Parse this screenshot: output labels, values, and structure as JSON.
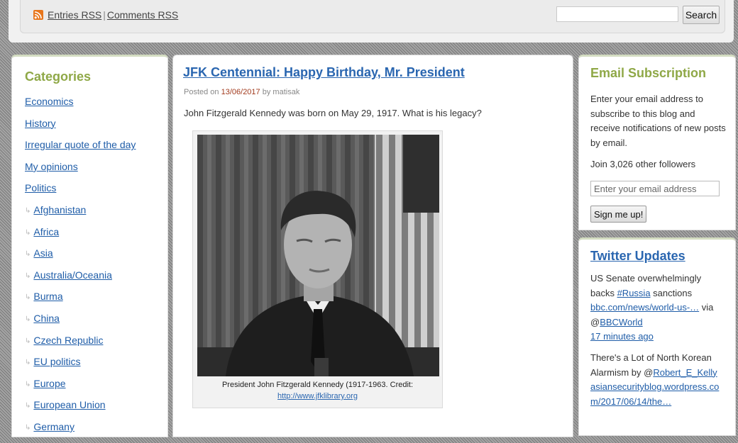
{
  "header": {
    "rss_icon": "rss-icon",
    "entries_rss": "Entries RSS",
    "separator": "|",
    "comments_rss": "Comments RSS",
    "search_placeholder": "",
    "search_button": "Search"
  },
  "sidebar": {
    "title": "Categories",
    "items": [
      {
        "label": "Economics",
        "child": false
      },
      {
        "label": "History",
        "child": false
      },
      {
        "label": "Irregular quote of the day",
        "child": false
      },
      {
        "label": "My opinions",
        "child": false
      },
      {
        "label": "Politics",
        "child": false
      },
      {
        "label": "Afghanistan",
        "child": true
      },
      {
        "label": "Africa",
        "child": true
      },
      {
        "label": "Asia",
        "child": true
      },
      {
        "label": "Australia/Oceania",
        "child": true
      },
      {
        "label": "Burma",
        "child": true
      },
      {
        "label": "China",
        "child": true
      },
      {
        "label": "Czech Republic",
        "child": true
      },
      {
        "label": "EU politics",
        "child": true
      },
      {
        "label": "Europe",
        "child": true
      },
      {
        "label": "European Union",
        "child": true
      },
      {
        "label": "Germany",
        "child": true
      }
    ]
  },
  "post": {
    "title": "JFK Centennial: Happy Birthday, Mr. President",
    "posted_on": "Posted on",
    "date": "13/06/2017",
    "by": "by",
    "author": "matisak",
    "intro": "John Fitzgerald Kennedy was born on May 29, 1917. What is his legacy?",
    "caption": "President John Fitzgerald Kennedy (1917-1963. Credit:",
    "caption_link": "http://www.jfklibrary.org"
  },
  "email_subscription": {
    "title": "Email Subscription",
    "description": "Enter your email address to subscribe to this blog and receive notifications of new posts by email.",
    "followers": "Join 3,026 other followers",
    "input_placeholder": "Enter your email address",
    "button": "Sign me up!"
  },
  "twitter": {
    "title": "Twitter Updates",
    "tweet1": {
      "text_before": "US Senate overwhelmingly backs ",
      "hashtag": "#Russia",
      "text_after": " sanctions ",
      "link": "bbc.com/news/world-us-…",
      "via": " via @",
      "handle": "BBCWorld",
      "time": "17 minutes ago"
    },
    "tweet2": {
      "text": "There's a Lot of North Korean Alarmism by @",
      "handle": "Robert_E_Kelly",
      "link": "asiansecurityblog.wordpress.com/2017/06/14/the…"
    }
  },
  "colors": {
    "accent_green": "#8fa847",
    "link_blue": "#2a66b0",
    "date_red": "#a23b1e"
  }
}
